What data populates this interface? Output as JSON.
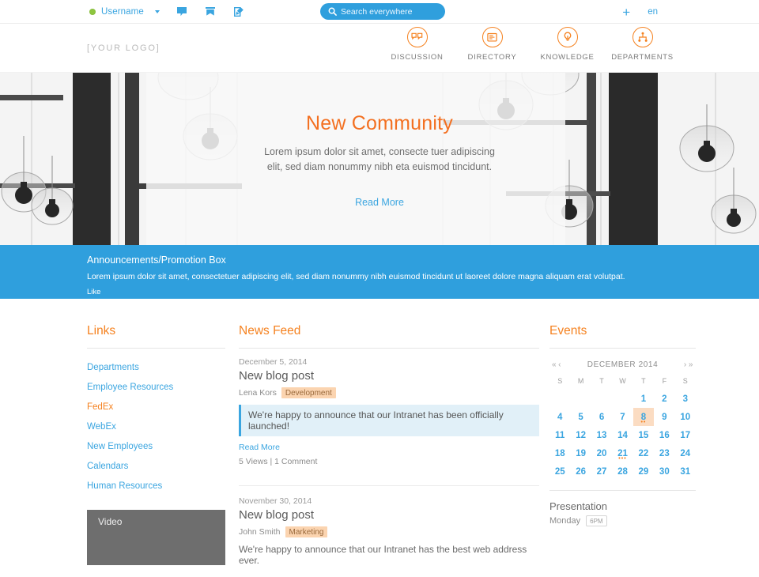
{
  "topbar": {
    "status_icon": "online-status-dot",
    "username": "Username",
    "caret_icon": "chevron-down-icon",
    "icons": [
      {
        "name": "messages-icon",
        "glyph": "message"
      },
      {
        "name": "bookmark-icon",
        "glyph": "bookmark"
      },
      {
        "name": "compose-icon",
        "glyph": "compose"
      }
    ],
    "search": {
      "icon": "search-icon",
      "placeholder": "Search everywhere",
      "value": ""
    },
    "add_label": "+",
    "language": "en"
  },
  "header": {
    "logo": "[YOUR LOGO]",
    "nav": [
      {
        "label": "DISCUSSION",
        "icon": "discussion-icon"
      },
      {
        "label": "DIRECTORY",
        "icon": "directory-icon"
      },
      {
        "label": "KNOWLEDGE",
        "icon": "knowledge-icon"
      },
      {
        "label": "DEPARTMENTS",
        "icon": "departments-icon"
      }
    ]
  },
  "hero": {
    "title": "New Community",
    "subtitle": "Lorem ipsum dolor sit amet, consecte tuer adipiscing elit, sed diam nonummy nibh eta euismod tincidunt.",
    "read_more": "Read More"
  },
  "announcement": {
    "title": "Announcements/Promotion Box",
    "body": "Lorem ipsum dolor sit amet, consectetuer adipiscing elit, sed diam nonummy nibh euismod tincidunt ut laoreet dolore magna aliquam erat volutpat.",
    "like_label": "Like"
  },
  "links": {
    "heading": "Links",
    "items": [
      {
        "label": "Departments",
        "style": "blue"
      },
      {
        "label": "Employee Resources",
        "style": "blue"
      },
      {
        "label": "FedEx",
        "style": "orange"
      },
      {
        "label": "WebEx",
        "style": "blue"
      },
      {
        "label": "New Employees",
        "style": "blue"
      },
      {
        "label": "Calendars",
        "style": "blue"
      },
      {
        "label": "Human Resources",
        "style": "blue"
      }
    ],
    "video_label": "Video"
  },
  "news_feed": {
    "heading": "News Feed",
    "posts": [
      {
        "date": "December 5, 2014",
        "title": "New blog post",
        "author": "Lena Kors",
        "tag": "Development",
        "quote": "We're happy to announce that our Intranet has been officially launched!",
        "read_more": "Read More",
        "stats": "5 Views | 1 Comment"
      },
      {
        "date": "November 30, 2014",
        "title": "New blog post",
        "author": "John Smith",
        "tag": "Marketing",
        "text": "We're happy to announce that our Intranet has the best web address ever."
      }
    ]
  },
  "events": {
    "heading": "Events",
    "calendar": {
      "first_label": "«",
      "prev_label": "‹",
      "month": "DECEMBER 2014",
      "next_label": "›",
      "last_label": "»",
      "weekdays": [
        "S",
        "M",
        "T",
        "W",
        "T",
        "F",
        "S"
      ],
      "weeks": [
        [
          null,
          null,
          null,
          null,
          1,
          2,
          3
        ],
        [
          4,
          5,
          6,
          7,
          8,
          9,
          10
        ],
        [
          11,
          12,
          13,
          14,
          15,
          16,
          17
        ],
        [
          18,
          19,
          20,
          21,
          22,
          23,
          24
        ],
        [
          25,
          26,
          27,
          28,
          29,
          30,
          31
        ]
      ],
      "today": 8,
      "event_dots": {
        "8": 2,
        "21": 3
      }
    },
    "list": [
      {
        "name": "Presentation",
        "day": "Monday",
        "time": "6PM"
      }
    ]
  },
  "colors": {
    "orange": "#f58220",
    "blue": "#3aa5e0",
    "announce_blue": "#2f9fdd",
    "status_green": "#8ec63f",
    "tag_bg": "#fbd4b0",
    "quote_bg": "#e1f0f8",
    "video_bg": "#6e6e6e"
  }
}
